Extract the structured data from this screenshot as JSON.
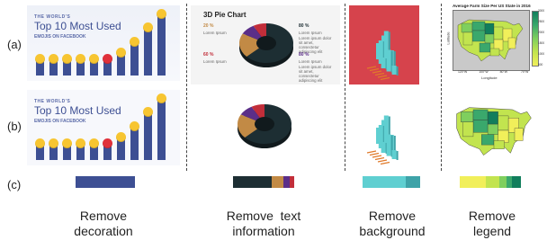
{
  "row_labels": [
    "(a)",
    "(b)",
    "(c)"
  ],
  "captions": [
    {
      "line1": "Remove",
      "line2": "decoration"
    },
    {
      "line1": "Remove  text",
      "line2": "information"
    },
    {
      "line1": "Remove",
      "line2": "background"
    },
    {
      "line1": "Remove",
      "line2": "legend"
    }
  ],
  "emoji_panel": {
    "kicker": "THE WORLD'S",
    "title": "Top 10 Most Used",
    "subtitle": "EMOJIS ON FACEBOOK",
    "bar_values": [
      1,
      1,
      1,
      1,
      1,
      1,
      1.35,
      1.9,
      2.6,
      3.3
    ],
    "bar_color": "#3d4f93"
  },
  "pie_panel": {
    "title": "3D Pie Chart",
    "pct_labels": [
      "20 %",
      "80 %",
      "60 %",
      "80 %"
    ],
    "item_label": "Lorem Ipsum",
    "body_text": "Lorem ipsum dolor sit amet, consectetur adipiscing elit",
    "segments": [
      {
        "color": "#1d2e33",
        "value": 0.63
      },
      {
        "color": "#c28a45",
        "value": 0.2
      },
      {
        "color": "#5b2e88",
        "value": 0.09
      },
      {
        "color": "#c22e3a",
        "value": 0.08
      }
    ]
  },
  "iso_panel": {
    "background": "#d6434c",
    "bar_color": "#5fcfd1",
    "strip_colors": [
      "#5fcfd1",
      "#3ea3a8"
    ],
    "strip_fractions": [
      0.75,
      0.25
    ]
  },
  "map_panel": {
    "title": "Average Farm Size Per US State in 2016",
    "xlabel": "Longitude",
    "ylabel": "Latitude",
    "xticks": [
      "120°W",
      "100°W",
      "80°W",
      "70°W"
    ],
    "legend_ticks": [
      "3000",
      "2500",
      "2000",
      "1500",
      "1000",
      "500"
    ],
    "palette": [
      "#f1ef5a",
      "#c2e44f",
      "#7fcf5e",
      "#3aa86c",
      "#117e5c"
    ],
    "strip_fractions": [
      0.42,
      0.22,
      0.12,
      0.1,
      0.14
    ]
  },
  "strips": {
    "emoji": [
      "#3d4f93"
    ],
    "pie": [
      "#1d2e33",
      "#c28a45",
      "#5b2e88",
      "#c22e3a"
    ],
    "pie_fractions": [
      0.63,
      0.2,
      0.09,
      0.08
    ]
  }
}
